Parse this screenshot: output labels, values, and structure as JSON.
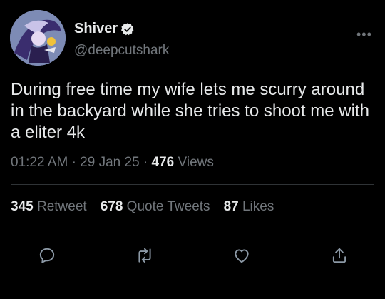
{
  "author": {
    "name": "Shiver",
    "handle": "@deepcutshark",
    "verified": true
  },
  "tweet": {
    "text": "During free time my wife lets me scurry around in the backyard while she tries to shoot me with a eliter 4k",
    "time": "01:22 AM",
    "separator1": "·",
    "date": "29 Jan 25",
    "separator2": "·",
    "views_count": "476",
    "views_label": "Views"
  },
  "stats": {
    "retweets_count": "345",
    "retweets_label": "Retweet",
    "quotes_count": "678",
    "quotes_label": "Quote Tweets",
    "likes_count": "87",
    "likes_label": "Likes"
  },
  "more_label": "•••",
  "icons": [
    "reply-icon",
    "retweet-icon",
    "like-icon",
    "share-icon",
    "verified-badge-icon",
    "more-icon"
  ],
  "colors": {
    "background": "#000000",
    "text": "#e7e9ea",
    "secondary": "#71767b",
    "divider": "#2f3336"
  }
}
